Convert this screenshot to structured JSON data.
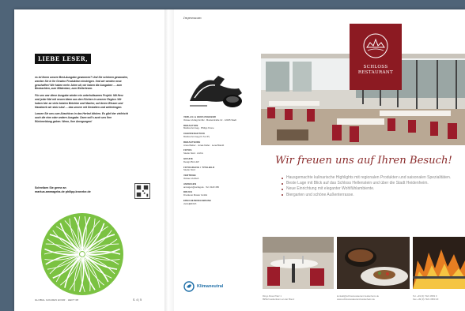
{
  "colors": {
    "backdrop": "#4f6478",
    "brand": "#8c1a22",
    "heading": "#8a2b2b",
    "tree": "#7bc242",
    "klima": "#1f6fa8"
  },
  "left_page": {
    "editorial_title": "LIEBE LESER,",
    "paragraphs": [
      "es ist Ihnen unsere Best-Ausgabe gewonnen? Und Sie schönen gewonden, werden Sie in Ihr Gewinn Produktion einsteigen. Und wir werden neue geschaffen! Wir haben mehr Jahre alt, wir haben die Ausgaben — zum Beobachten, zum Mitdenken, zum Weiterlesen.",
      "Für uns war diese Ausgabe wieder ein unterhaltsames Projekt. Mit Herz und jeder Mal mit neuen Ideen aus den Köchen in unserer Region. Wir haben hier an viele lokalen Betriebe und Macher, auf deren Wissen und Handwerk wir stolz sind — das unsere mit Gestalten und weitertragen.",
      "Lassen Sie uns zum Abschluss in das Herbst blicken. Es gibt hier vielleicht auch die eine oder andere Ausgabe. Dann soll's auch uns Ihre Rückmeldung geben. Wenn, Ihre Anregungen!"
    ],
    "signoff": "Schreiben Sie gerne an",
    "contacts": "markus.ammagebs.de   philipp.kronebe.de",
    "footer": "GLOBAL GOLDEN HOUR · HEFT 08",
    "page_number": "S. 4 | 5"
  },
  "right_page": {
    "section_label": "Impressum",
    "imprint": [
      {
        "h": "VERLAG & HERAUSGEBER",
        "t": "Ostsee Verlag GmbH · Musterstraße 12 · 12345 Stadt"
      },
      {
        "h": "REDAKTION",
        "t": "Markus Ammag · Philipp Krone"
      },
      {
        "h": "CHEFREDAKTION",
        "t": "Markus Ammag (V.i.S.d.P.)"
      },
      {
        "h": "REDAKTEURE",
        "t": "Anna Weber · Jonas Keller · Lena Brandt"
      },
      {
        "h": "FOTOS",
        "t": "Studio Nord · Archiv"
      },
      {
        "h": "GRAFIK",
        "t": "Design Büro Elf"
      },
      {
        "h": "FOTOGRAFIE / TITELBILD",
        "t": "Studio Nord"
      },
      {
        "h": "VERTRIEB",
        "t": "Ostsee Vertrieb"
      },
      {
        "h": "ANZEIGEN",
        "t": "anzeigen@verlag.de · Tel. 0123 456"
      },
      {
        "h": "DRUCK",
        "t": "Druckerei Muster GmbH"
      },
      {
        "h": "ERSCHEINUNGSWEISE",
        "t": "vierteljährlich"
      }
    ],
    "klima_label": "Klimaneutral",
    "ad": {
      "restaurant_name": "SCHLOSS RESTAURANT",
      "heading": "Wir freuen uns auf Ihren Besuch!",
      "bullets": [
        "Hausgemachte kulinarische Highlights mit regionalen Produkten und saisonalen Spezialitäten.",
        "Beste Lage mit Blick auf das Schloss Hellenstein und über die Stadt Heidenheim.",
        "Neue Einrichtung mit eleganter Wohlfühlambiente.",
        "Biergarten und schöne Außenterrasse."
      ],
      "footer": [
        "Ringo Rosé Platz 1<br>89522 Heidenheim an der Brenz",
        "kontakt@schlossrestaurant-heidenheim.de<br>www.schlossrestaurant-heidenheim.de",
        "Tel. +49 (0) 7321 3953 0<br>Fax +49 (0) 7321 3953 20"
      ]
    }
  }
}
